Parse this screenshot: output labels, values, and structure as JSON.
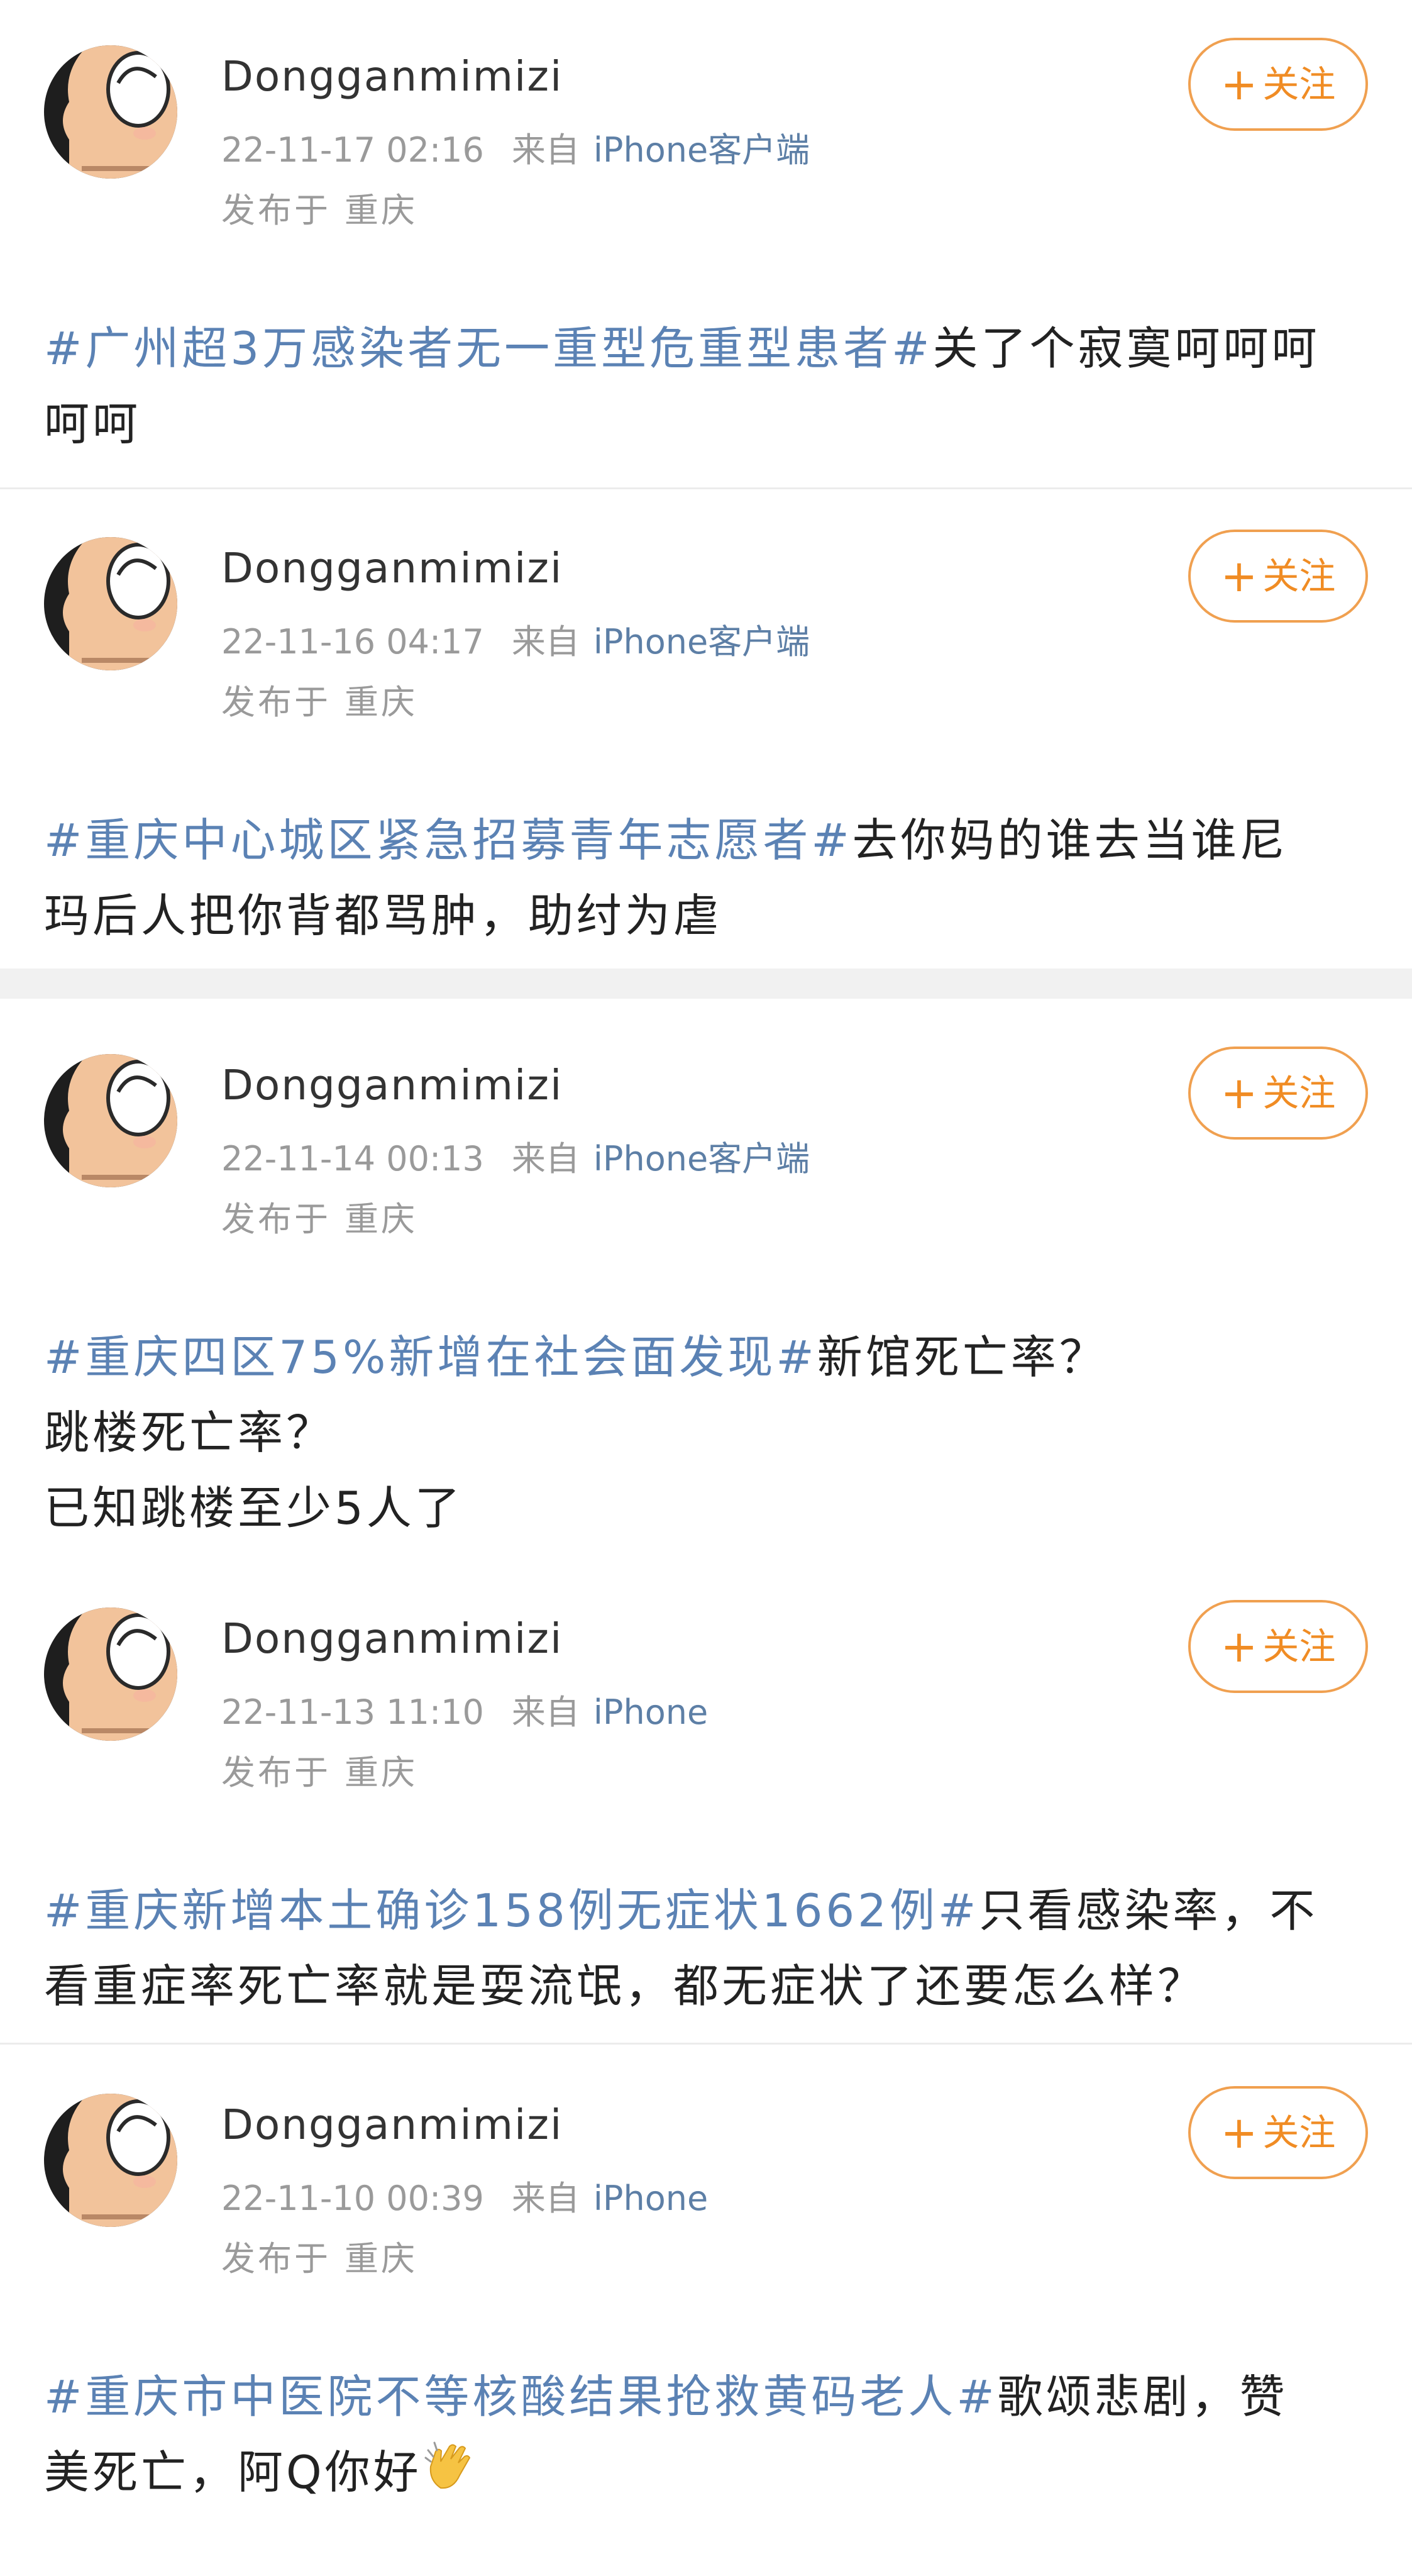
{
  "posts": [
    {
      "username": "Dongganmimizi",
      "time": "22-11-17 02:16",
      "from_label": "来自",
      "source": "iPhone客户端",
      "location_label": "发布于",
      "location": "重庆",
      "follow_label": "关注",
      "hashtag": "#广州超3万感染者无一重型危重型患者#",
      "text_line1": "关了个寂寞呵呵呵",
      "text_line2": "呵呵"
    },
    {
      "username": "Dongganmimizi",
      "time": "22-11-16 04:17",
      "from_label": "来自",
      "source": "iPhone客户端",
      "location_label": "发布于",
      "location": "重庆",
      "follow_label": "关注",
      "hashtag": "#重庆中心城区紧急招募青年志愿者#",
      "text_line1": "去你妈的谁去当谁尼",
      "text_line2": "玛后人把你背都骂肿，助纣为虐"
    },
    {
      "username": "Dongganmimizi",
      "time": "22-11-14 00:13",
      "from_label": "来自",
      "source": "iPhone客户端",
      "location_label": "发布于",
      "location": "重庆",
      "follow_label": "关注",
      "hashtag": "#重庆四区75%新增在社会面发现#",
      "text_line1": "新馆死亡率？",
      "text_line2": "跳楼死亡率？",
      "text_line3": "已知跳楼至少5人了"
    },
    {
      "username": "Dongganmimizi",
      "time": "22-11-13 11:10",
      "from_label": "来自",
      "source": "iPhone",
      "location_label": "发布于",
      "location": "重庆",
      "follow_label": "关注",
      "hashtag": "#重庆新增本土确诊158例无症状1662例#",
      "text_line1": "只看感染率，不",
      "text_line2": "看重症率死亡率就是耍流氓，都无症状了还要怎么样？"
    },
    {
      "username": "Dongganmimizi",
      "time": "22-11-10 00:39",
      "from_label": "来自",
      "source": "iPhone",
      "location_label": "发布于",
      "location": "重庆",
      "follow_label": "关注",
      "hashtag": "#重庆市中医院不等核酸结果抢救黄码老人#",
      "text_line1": "歌颂悲剧，赞",
      "text_line2": "美死亡，阿Q你好",
      "emoji": "clapping-hands"
    }
  ],
  "colors": {
    "hashtag": "#5b82b4",
    "source": "#5d7fa6",
    "follow": "#f08c24",
    "meta": "#9a9a9a"
  }
}
